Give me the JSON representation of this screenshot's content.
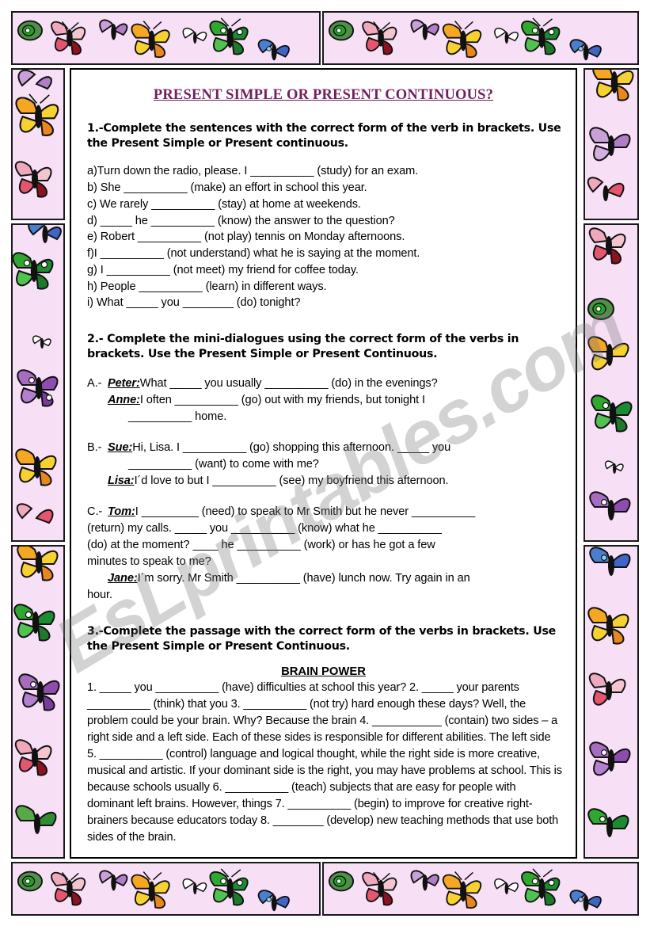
{
  "worksheet": {
    "title": "PRESENT SIMPLE OR PRESENT CONTINUOUS?",
    "title_color": "#70205f",
    "watermark": "EsLprintables.com",
    "border_theme": "butterflies",
    "border_background": "#f7dff5"
  },
  "exercise1": {
    "instruction": "1.-Complete the sentences with the correct form of the verb in brackets. Use the Present Simple or Present continuous.",
    "items": [
      "a)Turn down the radio, please. I __________ (study) for an exam.",
      "b) She __________ (make) an effort in school this year.",
      "c) We rarely __________ (stay) at home at weekends.",
      "d) _____ he __________ (know) the answer to the question?",
      "e) Robert __________ (not play) tennis on Monday afternoons.",
      "f)I __________ (not understand) what he is saying at the moment.",
      "g) I __________ (not meet) my friend for coffee today.",
      "h) People __________ (learn) in different ways.",
      "i) What _____ you ________ (do) tonight?"
    ]
  },
  "exercise2": {
    "instruction": "2.- Complete the mini-dialogues using the correct form of the verbs in brackets. Use the Present Simple or Present Continuous.",
    "dialogues": [
      {
        "mark": "A.-",
        "lines": [
          {
            "speaker": "Peter:",
            "text": "What _____ you usually __________ (do) in the evenings?",
            "indent": 0
          },
          {
            "speaker": "Anne:",
            "text": "I often __________ (go) out with my friends, but tonight I",
            "indent": 1
          },
          {
            "speaker": "",
            "text": "__________ home.",
            "indent": 2
          }
        ]
      },
      {
        "mark": "B.-",
        "lines": [
          {
            "speaker": "Sue:",
            "text": "Hi, Lisa. I __________ (go) shopping this afternoon. _____ you",
            "indent": 0
          },
          {
            "speaker": "",
            "text": "__________ (want) to come with me?",
            "indent": 2
          },
          {
            "speaker": "Lisa:",
            "text": "I´d love to but I __________ (see) my boyfriend this afternoon.",
            "indent": 1
          }
        ]
      },
      {
        "mark": "C.-",
        "lines": [
          {
            "speaker": "Tom:",
            "text": "I _________ (need) to speak to Mr Smith but he never __________",
            "indent": 0
          },
          {
            "speaker": "",
            "text": "(return) my calls. _____ you __________ (know) what he __________",
            "indent": 3
          },
          {
            "speaker": "",
            "text": "(do) at the moment? ____ he __________ (work) or has he got a few",
            "indent": 3
          },
          {
            "speaker": "",
            "text": "minutes to speak to me?",
            "indent": 3
          },
          {
            "speaker": "Jane:",
            "text": "I´m sorry. Mr Smith __________ (have) lunch now. Try again in an",
            "indent": 1
          },
          {
            "speaker": "",
            "text": "hour.",
            "indent": 3
          }
        ]
      }
    ]
  },
  "exercise3": {
    "instruction": "3.-Complete the passage with the correct form of the verbs in brackets. Use the Present Simple or Present Continuous.",
    "passage_title": "BRAIN POWER",
    "passage": "1. _____ you __________ (have) difficulties at school this year? 2. _____ your parents __________ (think) that you 3. __________ (not try) hard enough these days? Well, the problem could be your brain. Why? Because the brain 4. ___________ (contain) two sides – a right  side and a left side. Each of these sides is responsible for different abilities. The left side 5. __________ (control) language and logical thought, while the right side is more creative, musical and artistic. If your dominant side is the right, you may have problems at school. This is because schools usually 6. __________ (teach) subjects that are easy for people with  dominant left brains. However, things 7. __________ (begin) to improve for creative right-brainers because educators today 8. ________ (develop) new teaching methods that use both sides of the brain."
  }
}
